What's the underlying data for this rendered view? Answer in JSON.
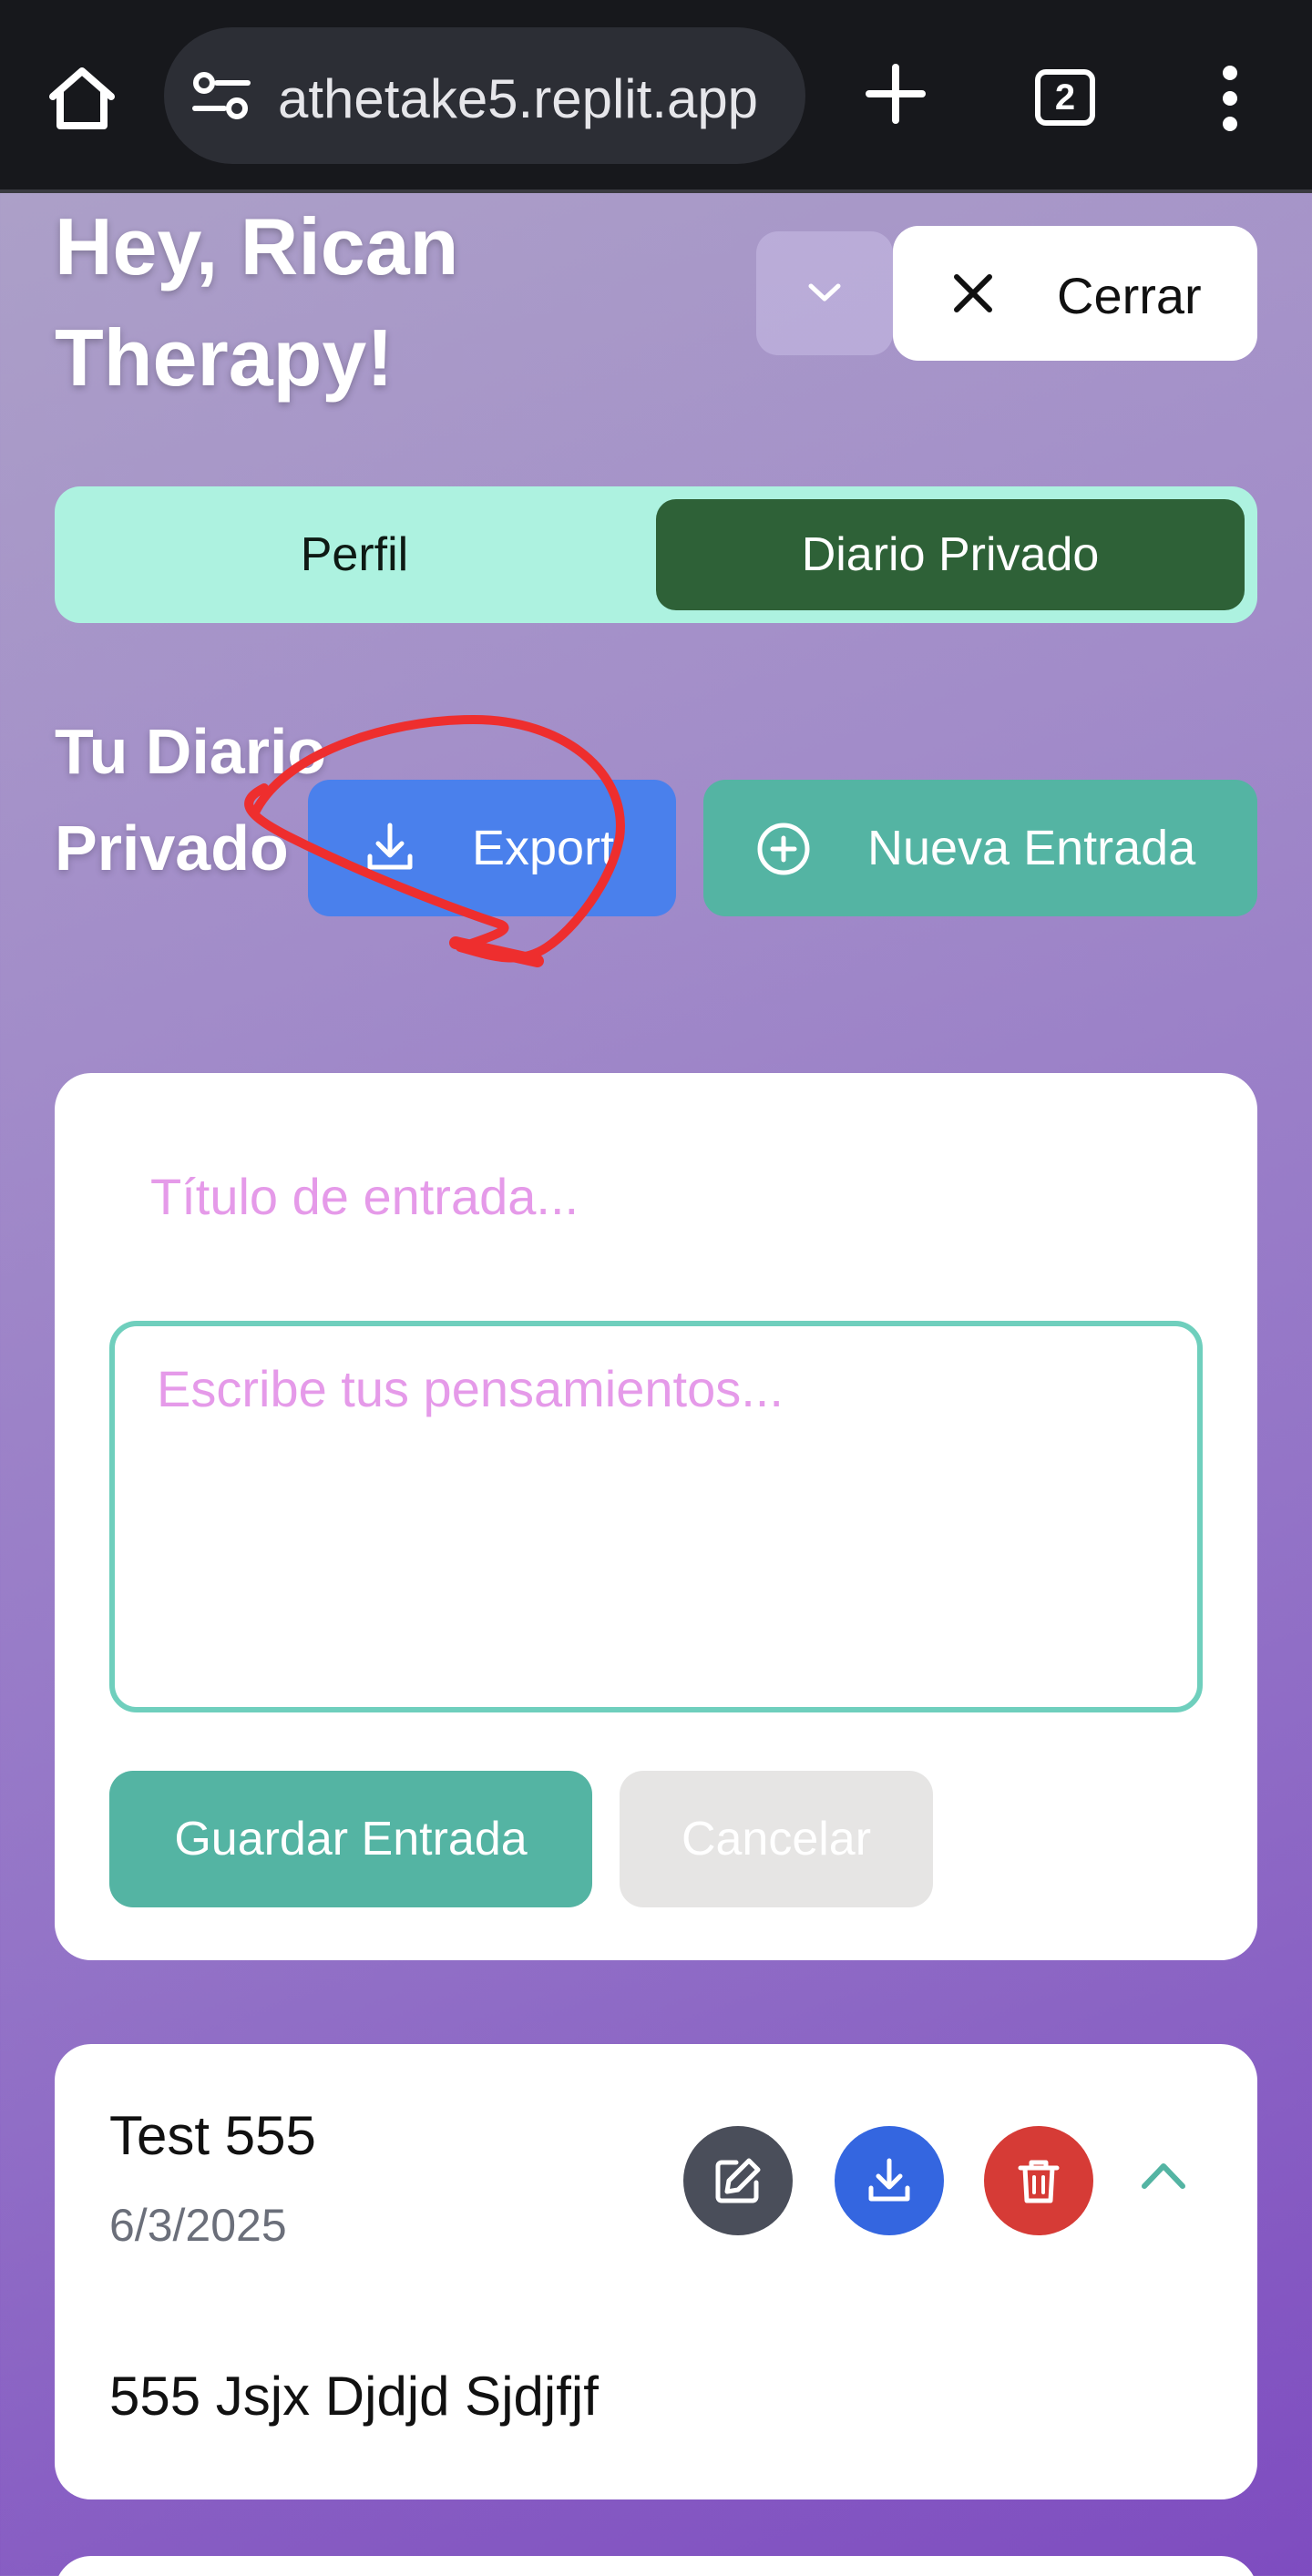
{
  "browser": {
    "url": "athetake5.replit.app",
    "tab_count": "2"
  },
  "header": {
    "greeting": "Hey, Rican Therapy!",
    "close_label": "Cerrar"
  },
  "tabs": [
    {
      "label": "Perfil",
      "active": false
    },
    {
      "label": "Diario Privado",
      "active": true
    }
  ],
  "diary": {
    "title": "Tu Diario Privado",
    "export_label": "Export",
    "new_entry_label": "Nueva Entrada"
  },
  "form": {
    "title_placeholder": "Título de entrada...",
    "body_placeholder": "Escribe tus pensamientos...",
    "save_label": "Guardar Entrada",
    "cancel_label": "Cancelar"
  },
  "entries": [
    {
      "title": "Test 555",
      "date": "6/3/2025",
      "text": "555 Jsjx Djdjd Sjdjfjf"
    }
  ],
  "colors": {
    "tab_active": "#2e6137",
    "tabbar_bg": "#adf2e0",
    "export_btn": "#4a80ec",
    "teal": "#54b4a3",
    "delete_red": "#d63b36",
    "placeholder_pink": "#e59ae9",
    "annotation_red": "#ee2e2e"
  },
  "icons": {
    "home": "home-icon",
    "site_settings": "tune-icon",
    "new_tab": "plus-icon",
    "menu": "more-vert-icon",
    "chevron_down": "chevron-down-icon",
    "close": "close-icon",
    "export": "download-icon",
    "new_entry": "plus-circle-icon",
    "edit": "edit-icon",
    "download": "download-icon",
    "delete": "trash-icon",
    "collapse": "chevron-up-icon"
  }
}
